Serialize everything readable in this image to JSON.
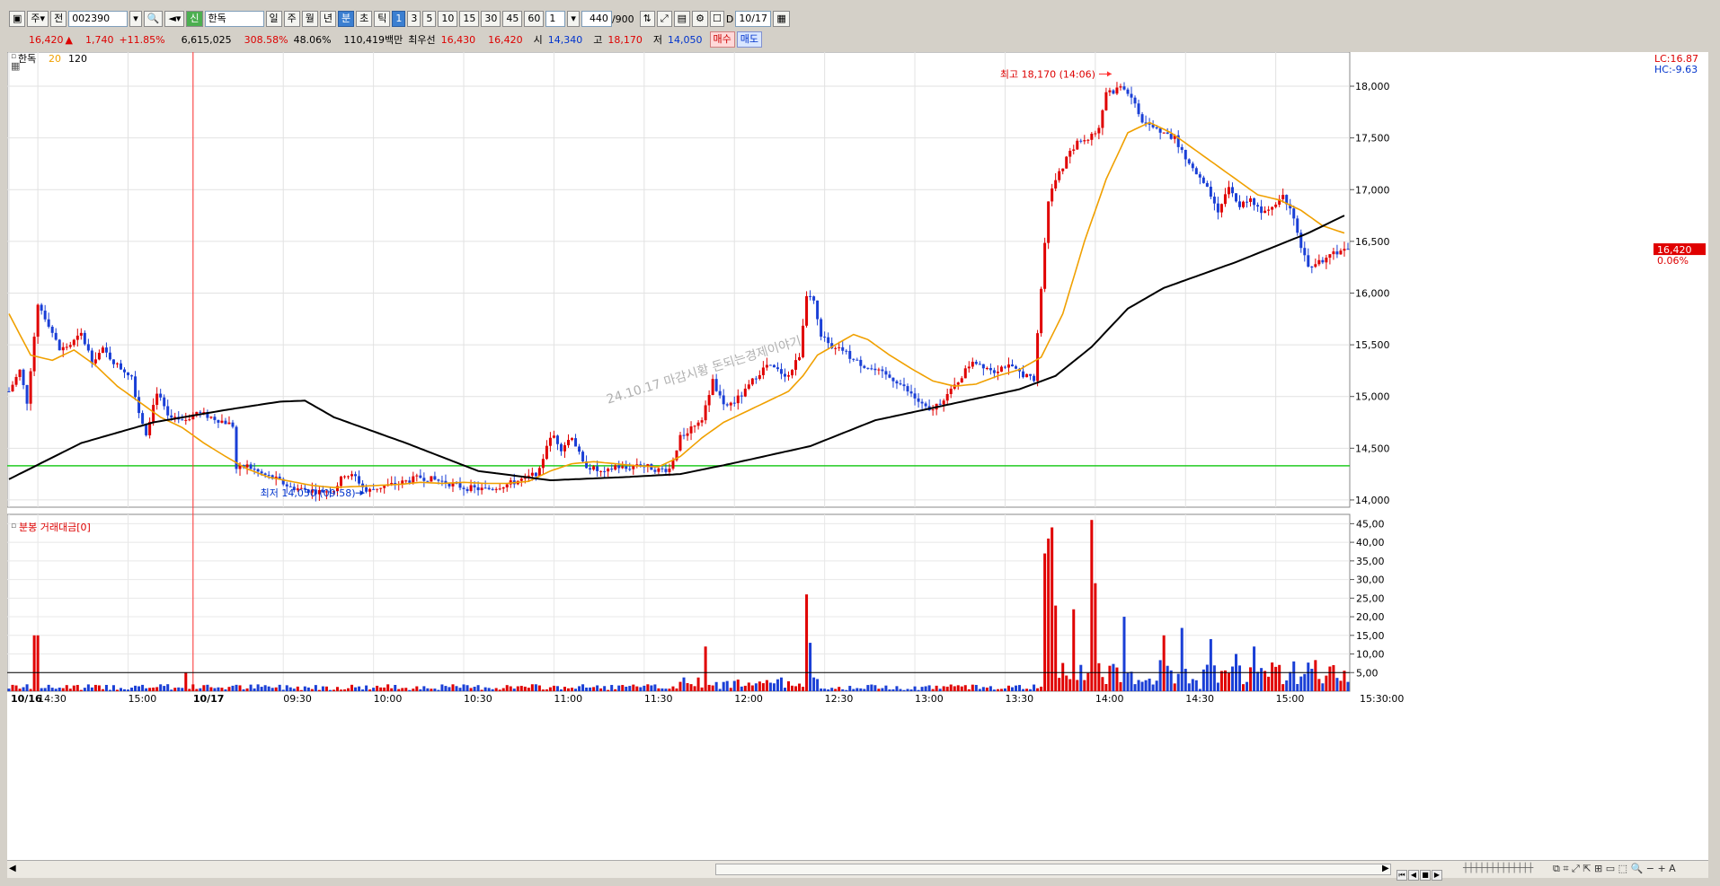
{
  "toolbar": {
    "type_label": "주",
    "full_label": "전",
    "code": "002390",
    "stock_name": "한독",
    "stock_badge": "신",
    "period_buttons": [
      "일",
      "주",
      "월",
      "년",
      "분",
      "초",
      "틱"
    ],
    "interval_buttons": [
      "1",
      "3",
      "5",
      "10",
      "15",
      "30",
      "45",
      "60"
    ],
    "interval_value": "1",
    "count": "440",
    "count_max": "/900",
    "d_label": "D",
    "date": "10/17"
  },
  "quote": {
    "price": "16,420",
    "arrow": "▲",
    "change": "1,740",
    "change_pct": "+11.85%",
    "volume": "6,615,025",
    "vol_ratio": "308.58%",
    "turnover": "48.06%",
    "amount": "110,419백만",
    "best_label": "최우선",
    "best_ask": "16,430",
    "best_bid": "16,420",
    "open_label": "시",
    "open": "14,340",
    "high_label": "고",
    "high": "18,170",
    "low_label": "저",
    "low": "14,050",
    "buy_label": "매수",
    "sell_label": "매도"
  },
  "legend": {
    "name": "한독",
    "ma20": "20",
    "ma120": "120"
  },
  "right_labels": {
    "lc": "LC:16.87",
    "hc": "HC:-9.63",
    "last": "16,420",
    "last_pct": "0.06%"
  },
  "watermark": "24.10.17 마감시황 돈되는경제이야기",
  "colors": {
    "up": "#e00000",
    "down": "#1a3fd6",
    "ma20": "#f0a000",
    "ma120": "#000000",
    "hline": "#22cc22",
    "marker": "#ff3030"
  },
  "chart_data": {
    "type": "candlestick",
    "price_axis": {
      "ticks": [
        14000,
        14500,
        15000,
        15500,
        16000,
        16500,
        17000,
        17500,
        18000
      ],
      "labels": [
        "14,000",
        "14,500",
        "15,000",
        "15,500",
        "16,000",
        "16,500",
        "17,000",
        "17,500",
        "18,000"
      ],
      "ylim": [
        13930,
        18330
      ]
    },
    "time_labels": [
      "10/16",
      "14:30",
      "15:00",
      "10/17",
      "09:30",
      "10:00",
      "10:30",
      "11:00",
      "11:30",
      "12:00",
      "12:30",
      "13:00",
      "13:30",
      "14:00",
      "14:30",
      "15:00",
      "15:30:00"
    ],
    "price_keys": [
      [
        0,
        15050
      ],
      [
        3,
        15250
      ],
      [
        5,
        14950
      ],
      [
        8,
        15900
      ],
      [
        11,
        15700
      ],
      [
        14,
        15450
      ],
      [
        17,
        15500
      ],
      [
        20,
        15600
      ],
      [
        23,
        15350
      ],
      [
        26,
        15450
      ],
      [
        30,
        15300
      ],
      [
        34,
        15200
      ],
      [
        36,
        14850
      ],
      [
        38,
        14650
      ],
      [
        41,
        15050
      ],
      [
        44,
        14800
      ],
      [
        48,
        14750
      ],
      [
        52,
        14850
      ],
      [
        56,
        14800
      ],
      [
        60,
        14750
      ],
      [
        62,
        14720
      ],
      [
        63,
        14300
      ],
      [
        66,
        14330
      ],
      [
        70,
        14250
      ],
      [
        74,
        14200
      ],
      [
        78,
        14120
      ],
      [
        82,
        14100
      ],
      [
        86,
        14080
      ],
      [
        90,
        14100
      ],
      [
        93,
        14250
      ],
      [
        96,
        14220
      ],
      [
        99,
        14080
      ],
      [
        102,
        14120
      ],
      [
        108,
        14160
      ],
      [
        114,
        14220
      ],
      [
        120,
        14180
      ],
      [
        126,
        14120
      ],
      [
        132,
        14100
      ],
      [
        138,
        14150
      ],
      [
        144,
        14220
      ],
      [
        147,
        14280
      ],
      [
        149,
        14540
      ],
      [
        151,
        14620
      ],
      [
        153,
        14500
      ],
      [
        156,
        14620
      ],
      [
        159,
        14350
      ],
      [
        162,
        14300
      ],
      [
        165,
        14250
      ],
      [
        168,
        14330
      ],
      [
        171,
        14300
      ],
      [
        174,
        14350
      ],
      [
        177,
        14320
      ],
      [
        180,
        14290
      ],
      [
        183,
        14300
      ],
      [
        186,
        14600
      ],
      [
        189,
        14700
      ],
      [
        192,
        14800
      ],
      [
        195,
        15150
      ],
      [
        198,
        14900
      ],
      [
        201,
        14950
      ],
      [
        204,
        15050
      ],
      [
        207,
        15200
      ],
      [
        210,
        15300
      ],
      [
        213,
        15250
      ],
      [
        216,
        15200
      ],
      [
        219,
        15400
      ],
      [
        221,
        16000
      ],
      [
        223,
        15900
      ],
      [
        225,
        15600
      ],
      [
        228,
        15450
      ],
      [
        231,
        15450
      ],
      [
        234,
        15350
      ],
      [
        237,
        15300
      ],
      [
        240,
        15250
      ],
      [
        243,
        15200
      ],
      [
        246,
        15150
      ],
      [
        249,
        15050
      ],
      [
        252,
        14950
      ],
      [
        255,
        14850
      ],
      [
        258,
        14950
      ],
      [
        261,
        15050
      ],
      [
        264,
        15200
      ],
      [
        267,
        15350
      ],
      [
        270,
        15300
      ],
      [
        273,
        15250
      ],
      [
        276,
        15300
      ],
      [
        279,
        15250
      ],
      [
        282,
        15200
      ],
      [
        284,
        15150
      ],
      [
        286,
        16050
      ],
      [
        288,
        16900
      ],
      [
        290,
        17100
      ],
      [
        293,
        17300
      ],
      [
        296,
        17450
      ],
      [
        299,
        17500
      ],
      [
        302,
        17600
      ],
      [
        304,
        17950
      ],
      [
        306,
        17950
      ],
      [
        308,
        18000
      ],
      [
        311,
        17900
      ],
      [
        314,
        17650
      ],
      [
        317,
        17600
      ],
      [
        320,
        17550
      ],
      [
        323,
        17500
      ],
      [
        326,
        17300
      ],
      [
        329,
        17150
      ],
      [
        332,
        17000
      ],
      [
        335,
        16800
      ],
      [
        338,
        17000
      ],
      [
        341,
        16850
      ],
      [
        344,
        16900
      ],
      [
        347,
        16800
      ],
      [
        350,
        16850
      ],
      [
        353,
        16950
      ],
      [
        356,
        16750
      ],
      [
        358,
        16450
      ],
      [
        360,
        16250
      ],
      [
        363,
        16300
      ],
      [
        366,
        16350
      ],
      [
        369,
        16420
      ]
    ],
    "ma20_keys": [
      [
        0,
        15800
      ],
      [
        6,
        15400
      ],
      [
        12,
        15350
      ],
      [
        18,
        15450
      ],
      [
        24,
        15300
      ],
      [
        30,
        15100
      ],
      [
        36,
        14950
      ],
      [
        42,
        14800
      ],
      [
        48,
        14700
      ],
      [
        54,
        14550
      ],
      [
        60,
        14420
      ],
      [
        66,
        14300
      ],
      [
        72,
        14220
      ],
      [
        78,
        14180
      ],
      [
        84,
        14140
      ],
      [
        90,
        14120
      ],
      [
        96,
        14130
      ],
      [
        102,
        14140
      ],
      [
        108,
        14150
      ],
      [
        114,
        14170
      ],
      [
        120,
        14160
      ],
      [
        126,
        14170
      ],
      [
        132,
        14160
      ],
      [
        138,
        14160
      ],
      [
        144,
        14180
      ],
      [
        150,
        14280
      ],
      [
        156,
        14350
      ],
      [
        162,
        14370
      ],
      [
        168,
        14350
      ],
      [
        174,
        14330
      ],
      [
        180,
        14320
      ],
      [
        186,
        14420
      ],
      [
        192,
        14600
      ],
      [
        198,
        14750
      ],
      [
        204,
        14850
      ],
      [
        210,
        14950
      ],
      [
        216,
        15050
      ],
      [
        220,
        15200
      ],
      [
        224,
        15400
      ],
      [
        230,
        15520
      ],
      [
        234,
        15600
      ],
      [
        238,
        15550
      ],
      [
        244,
        15400
      ],
      [
        250,
        15270
      ],
      [
        256,
        15150
      ],
      [
        262,
        15100
      ],
      [
        268,
        15120
      ],
      [
        274,
        15200
      ],
      [
        280,
        15260
      ],
      [
        286,
        15380
      ],
      [
        292,
        15800
      ],
      [
        298,
        16500
      ],
      [
        304,
        17100
      ],
      [
        310,
        17550
      ],
      [
        316,
        17650
      ],
      [
        322,
        17550
      ],
      [
        328,
        17400
      ],
      [
        334,
        17250
      ],
      [
        340,
        17100
      ],
      [
        346,
        16950
      ],
      [
        352,
        16900
      ],
      [
        358,
        16800
      ],
      [
        364,
        16650
      ],
      [
        370,
        16580
      ]
    ],
    "ma120_keys": [
      [
        0,
        14200
      ],
      [
        20,
        14550
      ],
      [
        40,
        14750
      ],
      [
        60,
        14870
      ],
      [
        75,
        14950
      ],
      [
        82,
        14960
      ],
      [
        90,
        14800
      ],
      [
        110,
        14550
      ],
      [
        130,
        14280
      ],
      [
        150,
        14190
      ],
      [
        170,
        14220
      ],
      [
        186,
        14250
      ],
      [
        200,
        14350
      ],
      [
        222,
        14520
      ],
      [
        240,
        14770
      ],
      [
        260,
        14920
      ],
      [
        280,
        15070
      ],
      [
        290,
        15200
      ],
      [
        300,
        15480
      ],
      [
        310,
        15850
      ],
      [
        320,
        16050
      ],
      [
        340,
        16300
      ],
      [
        360,
        16580
      ],
      [
        370,
        16750
      ]
    ],
    "volume_axis": {
      "ticks": [
        5,
        10,
        15,
        20,
        25,
        30,
        35,
        40,
        45
      ],
      "labels": [
        "5,00",
        "10,00",
        "15,00",
        "20,00",
        "25,00",
        "30,00",
        "35,00",
        "40,00",
        "45,00"
      ],
      "ylim": [
        0,
        47.5
      ]
    },
    "hline_price": 14330,
    "vline_index": 51,
    "high_marker": {
      "index": 306,
      "price": 18170,
      "label": "최고 18,170 (14:06)"
    },
    "low_marker": {
      "index": 99,
      "price": 14050,
      "label": "최저 14,050 (09:58)"
    },
    "volume_spikes": [
      [
        7,
        15
      ],
      [
        8,
        15
      ],
      [
        49,
        5
      ],
      [
        193,
        12
      ],
      [
        221,
        26
      ],
      [
        222,
        13
      ],
      [
        287,
        37
      ],
      [
        288,
        41
      ],
      [
        289,
        44
      ],
      [
        290,
        23
      ],
      [
        295,
        22
      ],
      [
        300,
        46
      ],
      [
        301,
        29
      ],
      [
        309,
        20
      ],
      [
        320,
        15
      ],
      [
        325,
        17
      ],
      [
        333,
        14
      ],
      [
        340,
        10
      ],
      [
        345,
        12
      ],
      [
        356,
        8
      ],
      [
        367,
        7
      ]
    ],
    "vol_panel_title": "분봉 거래대금[0]",
    "current_volume_line": 5
  },
  "scroll_icons": [
    "◀",
    "▶"
  ]
}
